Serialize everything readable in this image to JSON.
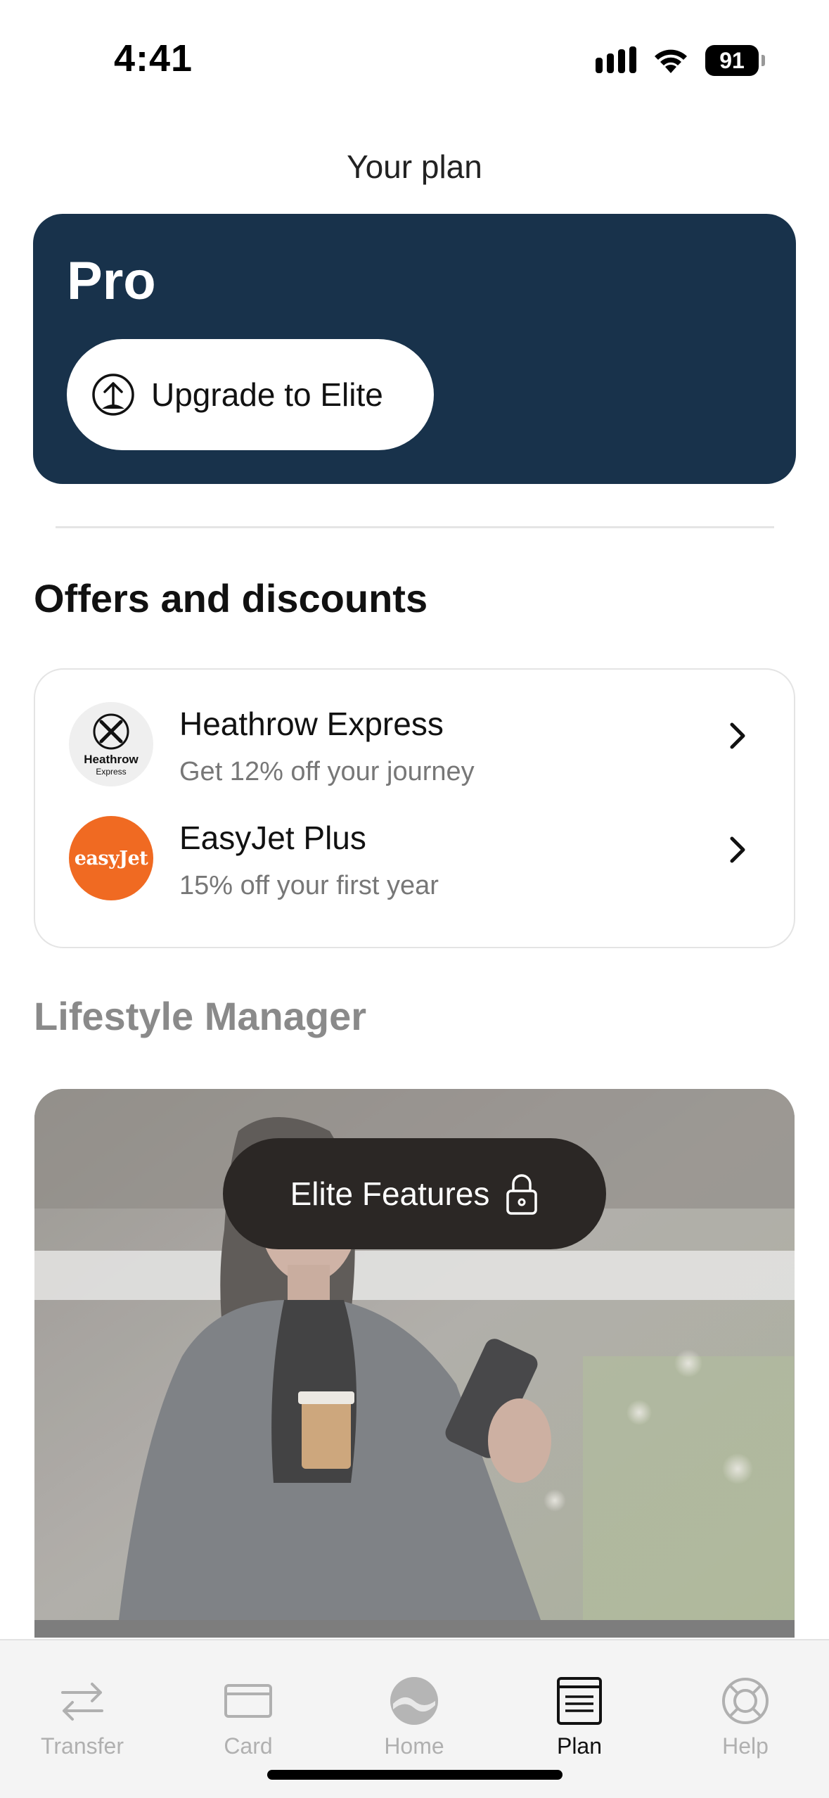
{
  "status_bar": {
    "time": "4:41",
    "battery": "91"
  },
  "page_title": "Your plan",
  "plan": {
    "name": "Pro",
    "upgrade_label": "Upgrade to Elite",
    "card_color": "#18324b"
  },
  "offers": {
    "title": "Offers and discounts",
    "items": [
      {
        "name": "Heathrow Express",
        "description": "Get 12% off your journey",
        "logo_text": "Heathrow",
        "logo_subtext": "Express"
      },
      {
        "name": "EasyJet Plus",
        "description": "15% off your first year",
        "logo_text": "easyJet",
        "logo_color": "#f06a22"
      }
    ]
  },
  "lifestyle": {
    "title": "Lifestyle Manager",
    "locked_label": "Elite Features"
  },
  "tab_bar": {
    "items": [
      {
        "label": "Transfer",
        "icon": "transfer-icon"
      },
      {
        "label": "Card",
        "icon": "card-icon"
      },
      {
        "label": "Home",
        "icon": "home-icon"
      },
      {
        "label": "Plan",
        "icon": "plan-icon",
        "active": true
      },
      {
        "label": "Help",
        "icon": "help-icon"
      }
    ]
  }
}
